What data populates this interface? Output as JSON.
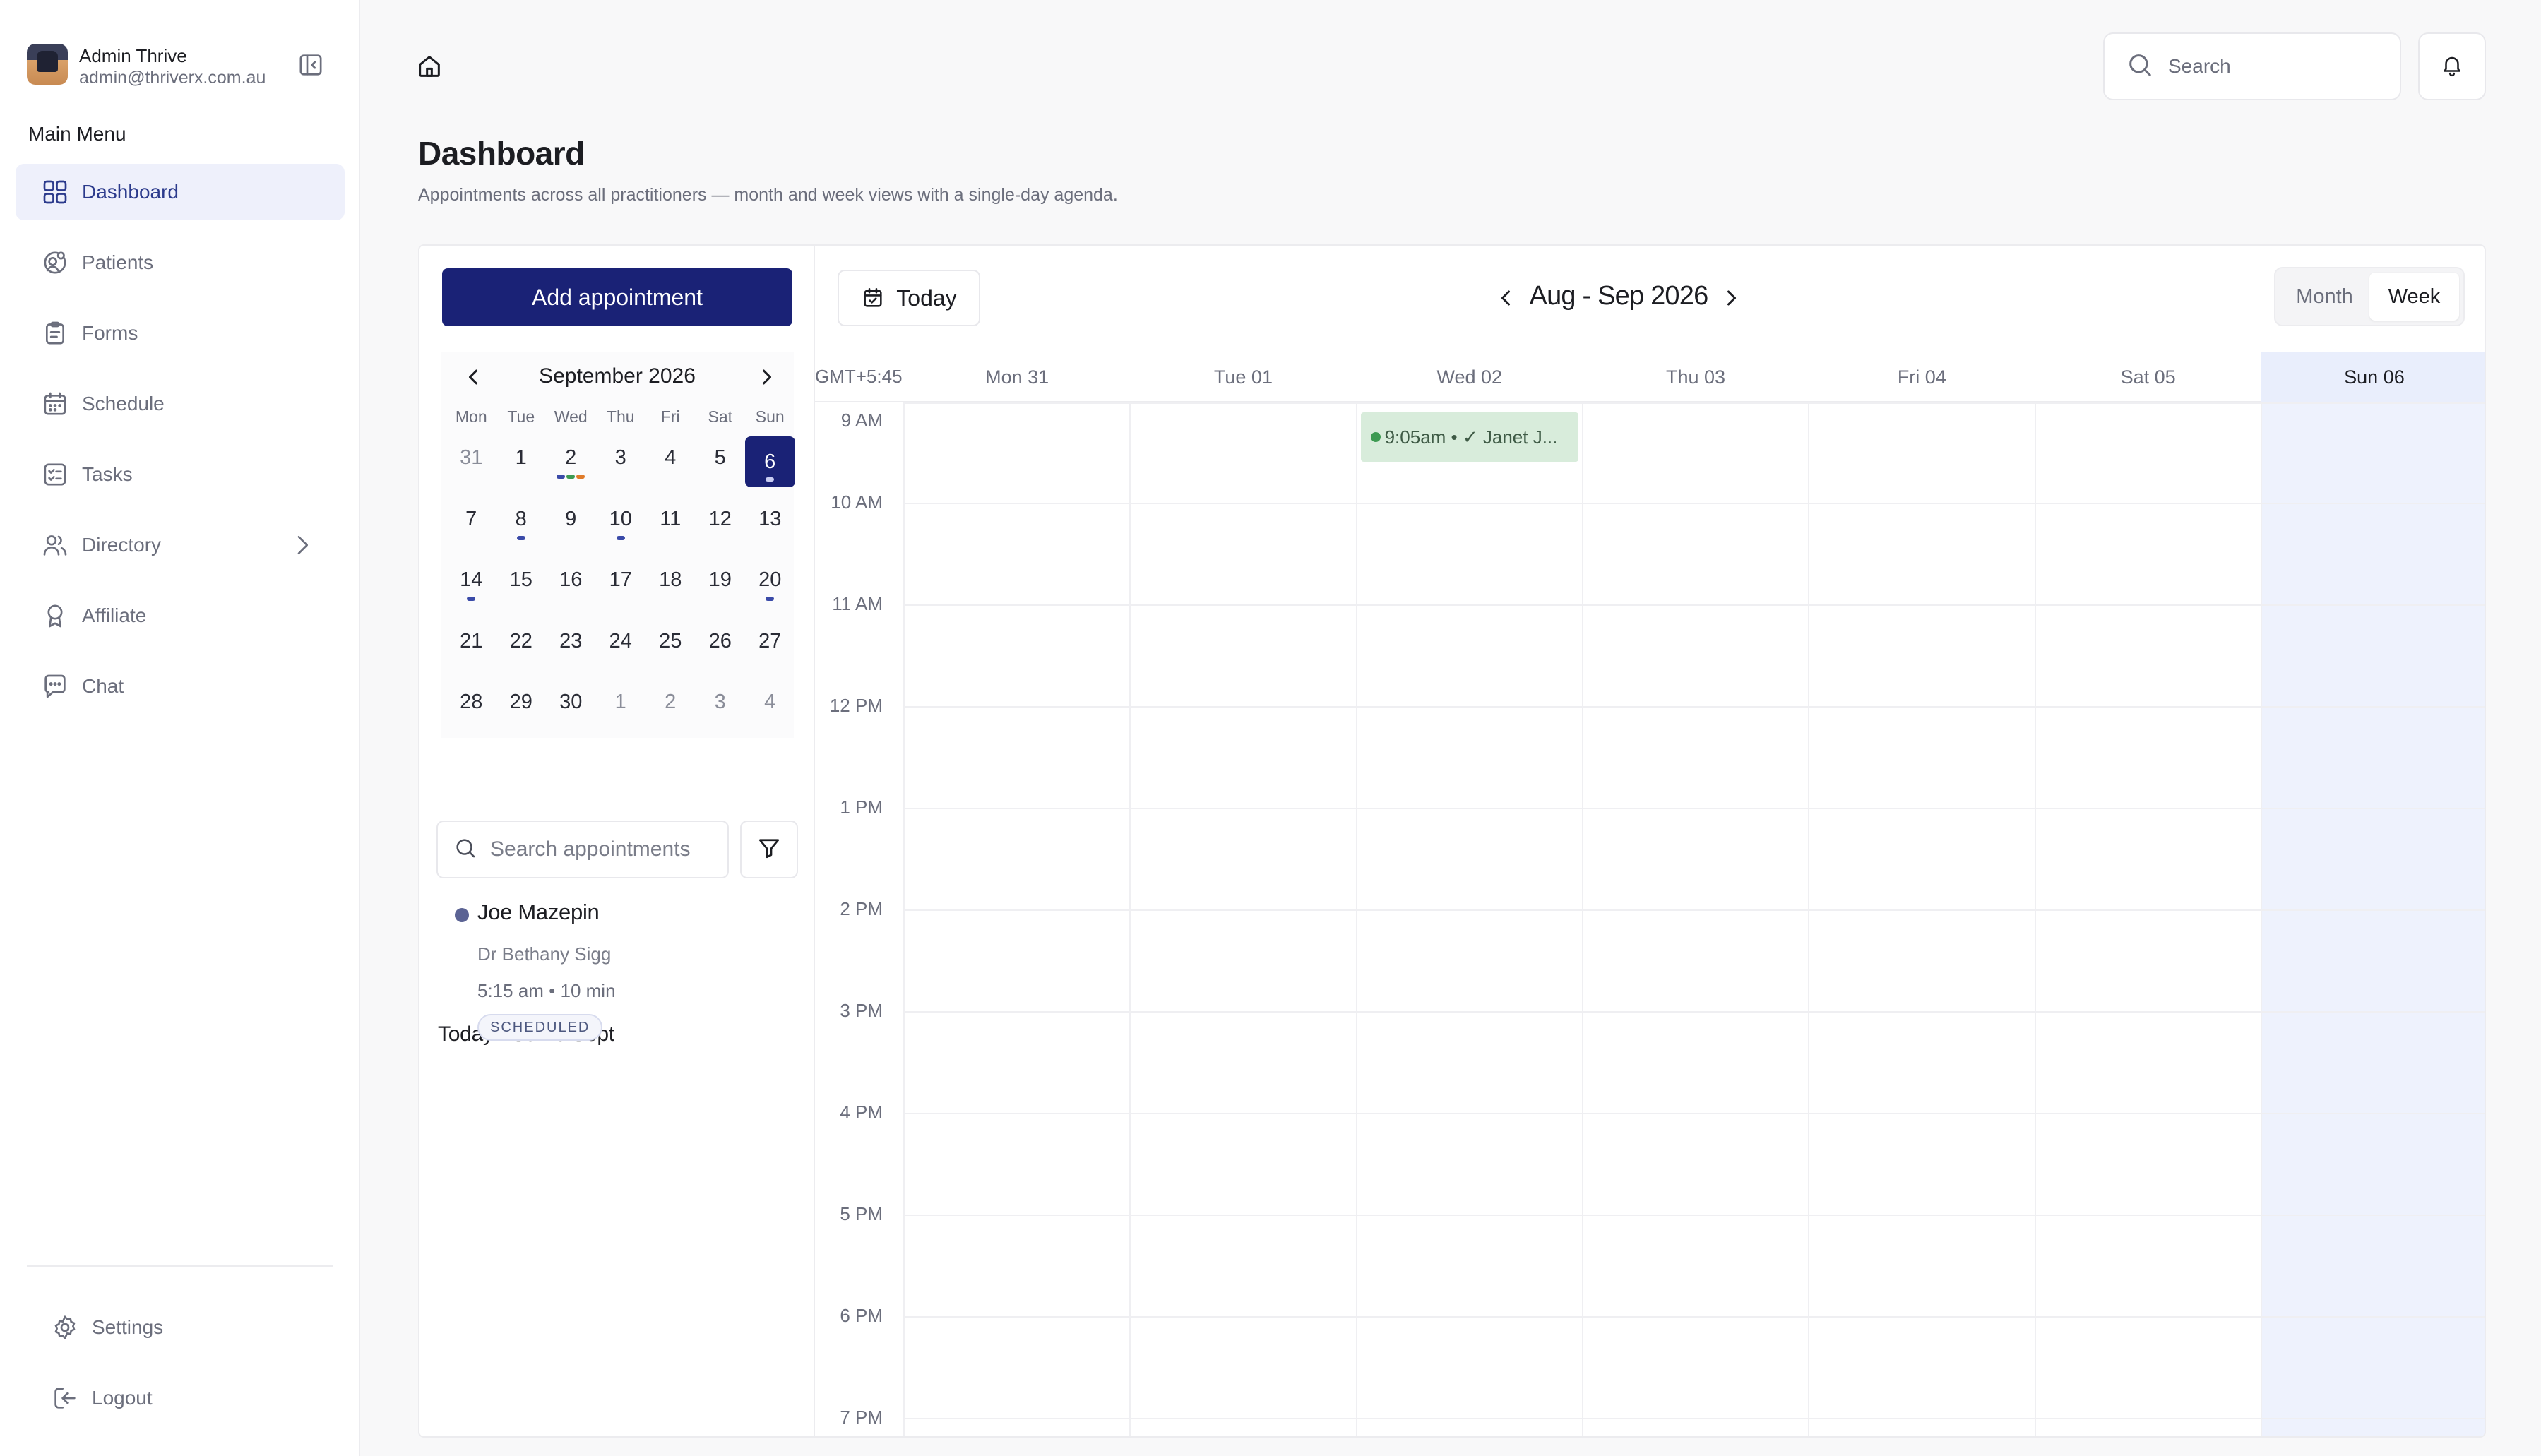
{
  "profile": {
    "name": "Admin Thrive",
    "email": "admin@thriverx.com.au"
  },
  "menu_heading": "Main Menu",
  "nav": [
    {
      "label": "Dashboard",
      "icon": "grid-icon",
      "active": true
    },
    {
      "label": "Patients",
      "icon": "patients-icon"
    },
    {
      "label": "Forms",
      "icon": "clipboard-icon"
    },
    {
      "label": "Schedule",
      "icon": "calendar-icon"
    },
    {
      "label": "Tasks",
      "icon": "checklist-icon"
    },
    {
      "label": "Directory",
      "icon": "users-icon",
      "has_chevron": true
    },
    {
      "label": "Affiliate",
      "icon": "award-icon"
    },
    {
      "label": "Chat",
      "icon": "chat-icon"
    }
  ],
  "bottom_nav": [
    {
      "label": "Settings",
      "icon": "gear-icon"
    },
    {
      "label": "Logout",
      "icon": "logout-icon"
    }
  ],
  "topbar": {
    "search_placeholder": "Search"
  },
  "page": {
    "title": "Dashboard",
    "subtitle": "Appointments across all practitioners — month and week views with a single-day agenda."
  },
  "left_panel": {
    "add_button": "Add appointment",
    "mini_calendar": {
      "title": "September 2026",
      "weekdays": [
        "Mon",
        "Tue",
        "Wed",
        "Thu",
        "Fri",
        "Sat",
        "Sun"
      ],
      "weeks": [
        [
          {
            "d": "31",
            "muted": true
          },
          {
            "d": "1"
          },
          {
            "d": "2",
            "dots": [
              "#3a4aa8",
              "#3d9a52",
              "#e07b2a"
            ]
          },
          {
            "d": "3"
          },
          {
            "d": "4"
          },
          {
            "d": "5"
          },
          {
            "d": "6",
            "selected": true,
            "dots": [
              "#c8ccf2"
            ]
          }
        ],
        [
          {
            "d": "7"
          },
          {
            "d": "8",
            "dots": [
              "#3a4aa8"
            ]
          },
          {
            "d": "9"
          },
          {
            "d": "10",
            "dots": [
              "#3a4aa8"
            ]
          },
          {
            "d": "11"
          },
          {
            "d": "12"
          },
          {
            "d": "13"
          }
        ],
        [
          {
            "d": "14",
            "dots": [
              "#3a4aa8"
            ]
          },
          {
            "d": "15"
          },
          {
            "d": "16"
          },
          {
            "d": "17"
          },
          {
            "d": "18"
          },
          {
            "d": "19"
          },
          {
            "d": "20",
            "dots": [
              "#3a4aa8"
            ]
          }
        ],
        [
          {
            "d": "21"
          },
          {
            "d": "22"
          },
          {
            "d": "23"
          },
          {
            "d": "24"
          },
          {
            "d": "25"
          },
          {
            "d": "26"
          },
          {
            "d": "27"
          }
        ],
        [
          {
            "d": "28"
          },
          {
            "d": "29"
          },
          {
            "d": "30"
          },
          {
            "d": "1",
            "muted": true
          },
          {
            "d": "2",
            "muted": true
          },
          {
            "d": "3",
            "muted": true
          },
          {
            "d": "4",
            "muted": true
          }
        ]
      ]
    },
    "agenda_title": "Today - Sun 6 Sept",
    "appt_search_placeholder": "Search appointments",
    "agenda_items": [
      {
        "patient": "Joe Mazepin",
        "practitioner": "Dr Bethany Sigg",
        "time": "5:15 am • 10 min",
        "status": "SCHEDULED",
        "color": "#5b6394"
      }
    ]
  },
  "week_view": {
    "today_button": "Today",
    "range_label": "Aug - Sep 2026",
    "views": [
      "Month",
      "Week"
    ],
    "active_view": "Week",
    "timezone": "GMT+5:45",
    "days": [
      "Mon 31",
      "Tue 01",
      "Wed 02",
      "Thu 03",
      "Fri 04",
      "Sat 05",
      "Sun 06"
    ],
    "today_index": 6,
    "hours": [
      "9 AM",
      "10 AM",
      "11 AM",
      "12 PM",
      "1 PM",
      "2 PM",
      "3 PM",
      "4 PM",
      "5 PM",
      "6 PM",
      "7 PM"
    ],
    "events": [
      {
        "label": "9:05am • ✓ Janet J...",
        "day_index": 2,
        "color": "#d8ecdb",
        "dot_color": "#3d9a52"
      }
    ]
  }
}
